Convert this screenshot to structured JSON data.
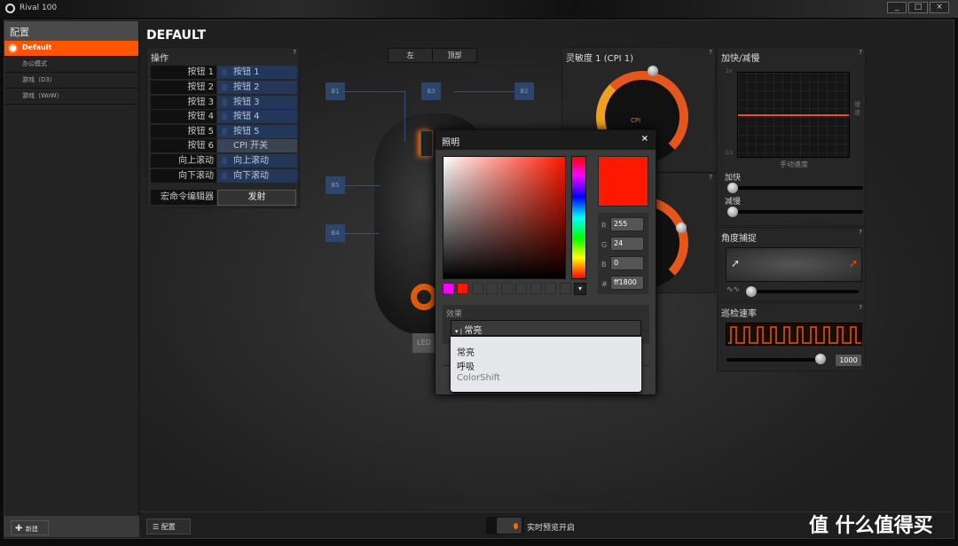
{
  "window": {
    "title": "Rival 100",
    "controls": [
      "_",
      "□",
      "×"
    ]
  },
  "sidebar": {
    "header": "配置",
    "items": [
      {
        "label": "Default",
        "active": true
      },
      {
        "label": "办公模式"
      },
      {
        "label": "游戏（D3）"
      },
      {
        "label": "游戏（WoW）"
      }
    ],
    "new_label": "新建"
  },
  "main": {
    "title": "DEFAULT",
    "actions": {
      "title": "操作",
      "help": "?",
      "rows": [
        {
          "button": "按钮 1",
          "action": "按钮 1"
        },
        {
          "button": "按钮 2",
          "action": "按钮 2"
        },
        {
          "button": "按钮 3",
          "action": "按钮 3"
        },
        {
          "button": "按钮 4",
          "action": "按钮 4"
        },
        {
          "button": "按钮 5",
          "action": "按钮 5"
        },
        {
          "button": "按钮 6",
          "action": "CPI 开关"
        },
        {
          "button": "向上滚动",
          "action": "向上滚动"
        },
        {
          "button": "向下滚动",
          "action": "向下滚动"
        }
      ],
      "macro_label": "宏命令编辑器",
      "macro_button": "发射"
    },
    "view_tabs": [
      "左",
      "顶部"
    ],
    "mouse_labels": [
      "B1",
      "B2",
      "B3",
      "B4",
      "B5",
      "LED"
    ],
    "cpi": {
      "title": "灵敏度 1 (CPI 1)",
      "gauge_label": "CPI",
      "help": "?"
    },
    "accel": {
      "title": "加快/减慢",
      "max_label": "2x",
      "min_label": "1/2",
      "x_label": "手动速度",
      "side_label": "慢速",
      "accel_label": "加快",
      "decel_label": "减慢",
      "help": "?"
    },
    "angle": {
      "title": "角度捕捉",
      "help": "?"
    },
    "polling": {
      "title": "巡检速率",
      "value": "1000",
      "help": "?"
    }
  },
  "lighting_dialog": {
    "title": "照明",
    "close": "×",
    "color": "#ff1800",
    "r": "255",
    "g": "24",
    "b": "0",
    "hex": "ff1800",
    "recent": [
      "#ff00ff",
      "#ff1800"
    ],
    "effect_label": "效果",
    "effect_selected": "常亮",
    "effect_options": [
      "常亮",
      "呼吸",
      "ColorShift"
    ]
  },
  "footer": {
    "config_label": "配置",
    "preview_label": "实时预览开启"
  },
  "watermark": "值 什么值得买",
  "colors": {
    "accent": "#ff5500",
    "button_blue": "#233759"
  }
}
